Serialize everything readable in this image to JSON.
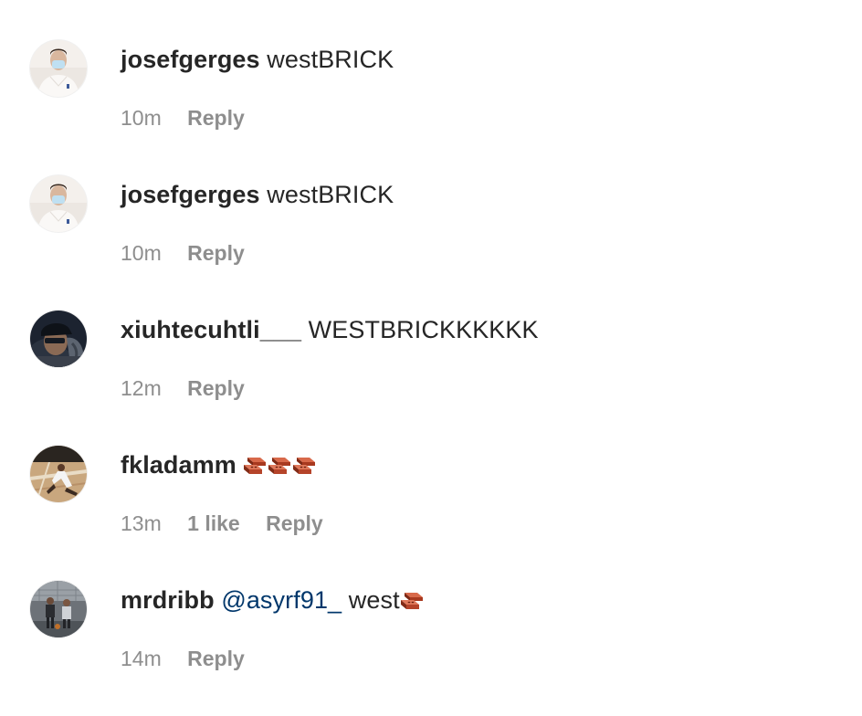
{
  "comments": [
    {
      "avatar": "person-in-white-shirt-with-mask",
      "username": "josefgerges",
      "text": "westBRICK",
      "time": "10m",
      "reply_label": "Reply"
    },
    {
      "avatar": "person-in-white-shirt-with-mask",
      "username": "josefgerges",
      "text": "westBRICK",
      "time": "10m",
      "reply_label": "Reply"
    },
    {
      "avatar": "person-with-cap-dark-background",
      "username": "xiuhtecuhtli___",
      "text": "WESTBRICKKKKKK",
      "time": "12m",
      "reply_label": "Reply"
    },
    {
      "avatar": "basketball-court-dunk",
      "username": "fkladamm",
      "text": "",
      "emoji": "brick-emoji",
      "emoji_count": 3,
      "time": "13m",
      "likes": "1 like",
      "reply_label": "Reply"
    },
    {
      "avatar": "basketball-players-outdoor-court",
      "username": "mrdribb",
      "mention": "@asyrf91_",
      "text": "west",
      "emoji": "brick-emoji",
      "emoji_count": 1,
      "time": "14m",
      "reply_label": "Reply"
    }
  ],
  "colors": {
    "text": "#262626",
    "meta": "#8e8e8e",
    "mention": "#00376b",
    "brick": "#b5442a"
  }
}
